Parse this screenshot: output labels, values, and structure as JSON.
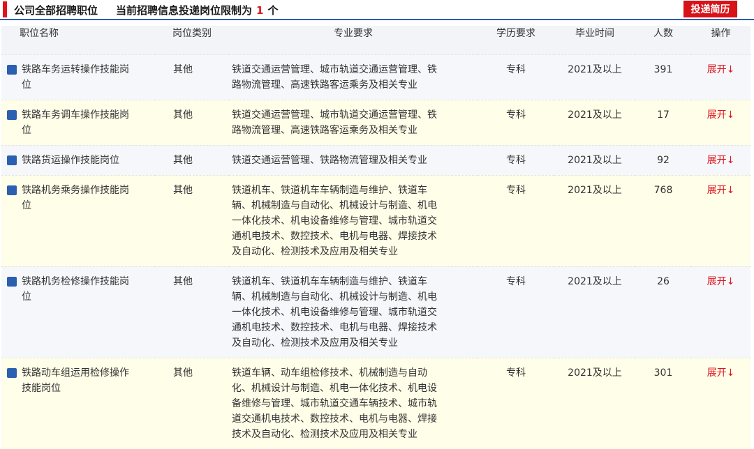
{
  "header": {
    "title": "公司全部招聘职位",
    "limit_prefix": "当前招聘信息投递岗位限制为",
    "limit_value": "1",
    "limit_suffix": "个",
    "apply_label": "投递简历"
  },
  "colors": {
    "accent": "#e0141c",
    "blue": "#2b5fb0",
    "row_odd": "#f6f7fb",
    "row_even": "#fffee8"
  },
  "table": {
    "headers": [
      "职位名称",
      "岗位类别",
      "专业要求",
      "学历要求",
      "毕业时间",
      "人数",
      "操作"
    ],
    "rows": [
      {
        "name": "铁路车务运转操作技能岗位",
        "category": "其他",
        "major": "铁道交通运营管理、城市轨道交通运营管理、铁路物流管理、高速铁路客运乘务及相关专业",
        "education": "专科",
        "graduation": "2021及以上",
        "count": "391",
        "action": "展开↓"
      },
      {
        "name": "铁路车务调车操作技能岗位",
        "category": "其他",
        "major": "铁道交通运营管理、城市轨道交通运营管理、铁路物流管理、高速铁路客运乘务及相关专业",
        "education": "专科",
        "graduation": "2021及以上",
        "count": "17",
        "action": "展开↓"
      },
      {
        "name": "铁路货运操作技能岗位",
        "category": "其他",
        "major": "铁道交通运营管理、铁路物流管理及相关专业",
        "education": "专科",
        "graduation": "2021及以上",
        "count": "92",
        "action": "展开↓"
      },
      {
        "name": "铁路机务乘务操作技能岗位",
        "category": "其他",
        "major": "铁道机车、铁道机车车辆制造与维护、铁道车辆、机械制造与自动化、机械设计与制造、机电一体化技术、机电设备维修与管理、城市轨道交通机电技术、数控技术、电机与电器、焊接技术及自动化、检测技术及应用及相关专业",
        "education": "专科",
        "graduation": "2021及以上",
        "count": "768",
        "action": "展开↓"
      },
      {
        "name": "铁路机务检修操作技能岗位",
        "category": "其他",
        "major": "铁道机车、铁道机车车辆制造与维护、铁道车辆、机械制造与自动化、机械设计与制造、机电一体化技术、机电设备维修与管理、城市轨道交通机电技术、数控技术、电机与电器、焊接技术及自动化、检测技术及应用及相关专业",
        "education": "专科",
        "graduation": "2021及以上",
        "count": "26",
        "action": "展开↓"
      },
      {
        "name": "铁路动车组运用检修操作技能岗位",
        "category": "其他",
        "major": "铁道车辆、动车组检修技术、机械制造与自动化、机械设计与制造、机电一体化技术、机电设备维修与管理、城市轨道交通车辆技术、城市轨道交通机电技术、数控技术、电机与电器、焊接技术及自动化、检测技术及应用及相关专业",
        "education": "专科",
        "graduation": "2021及以上",
        "count": "301",
        "action": "展开↓"
      }
    ]
  }
}
